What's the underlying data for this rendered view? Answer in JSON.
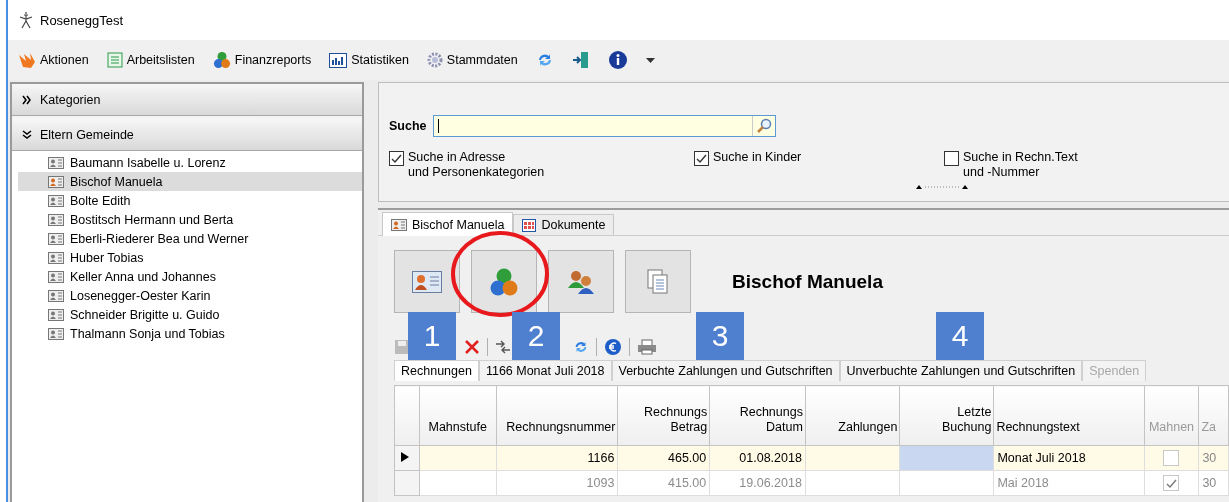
{
  "window": {
    "title": "RoseneggTest"
  },
  "toolbar": {
    "items": [
      {
        "label": "Aktionen"
      },
      {
        "label": "Arbeitslisten"
      },
      {
        "label": "Finanzreports"
      },
      {
        "label": "Statistiken"
      },
      {
        "label": "Stammdaten"
      }
    ]
  },
  "sidebar": {
    "sections": [
      {
        "label": "Kategorien",
        "expanded": false
      },
      {
        "label": "Eltern Gemeinde",
        "expanded": true,
        "items": [
          {
            "label": "Baumann Isabelle u. Lorenz",
            "selected": false
          },
          {
            "label": "Bischof Manuela",
            "selected": true
          },
          {
            "label": "Bolte Edith",
            "selected": false
          },
          {
            "label": "Bostitsch Hermann und Berta",
            "selected": false
          },
          {
            "label": "Eberli-Riederer Bea und Werner",
            "selected": false
          },
          {
            "label": "Huber Tobias",
            "selected": false
          },
          {
            "label": "Keller Anna und Johannes",
            "selected": false
          },
          {
            "label": "Losenegger-Oester Karin",
            "selected": false
          },
          {
            "label": "Schneider Brigitte u. Guido",
            "selected": false
          },
          {
            "label": "Thalmann Sonja und Tobias",
            "selected": false
          }
        ]
      }
    ]
  },
  "search": {
    "label": "Suche",
    "options": [
      {
        "label": "Suche in Adresse\nund Personenkategorien",
        "checked": true
      },
      {
        "label": "Suche in Kinder",
        "checked": true
      },
      {
        "label": "Suche in Rechn.Text\nund -Nummer",
        "checked": false
      }
    ]
  },
  "record_tabs": [
    {
      "label": "Bischof Manuela",
      "selected": true
    },
    {
      "label": "Dokumente",
      "selected": false
    }
  ],
  "record": {
    "name": "Bischof Manuela"
  },
  "sub_tabs": [
    {
      "label": "Rechnungen",
      "selected": true,
      "disabled": false
    },
    {
      "label": "1166 Monat Juli 2018",
      "selected": false,
      "disabled": false
    },
    {
      "label": "Verbuchte Zahlungen und Gutschriften",
      "selected": false,
      "disabled": false
    },
    {
      "label": "Unverbuchte Zahlungen und Gutschriften",
      "selected": false,
      "disabled": false
    },
    {
      "label": "Spenden",
      "selected": false,
      "disabled": true
    }
  ],
  "table": {
    "columns": [
      "Mahnstufe",
      "Rechnungsnummer",
      "Rechnungs\nBetrag",
      "Rechnungs\nDatum",
      "Zahlungen",
      "Letzte\nBuchung",
      "Rechnungstext",
      "Mahnen",
      "Za"
    ],
    "rows": [
      {
        "selected": true,
        "rechnungsnummer": "1166",
        "betrag": "465.00",
        "datum": "01.08.2018",
        "rechnungstext": "Monat Juli 2018",
        "mahnen": false,
        "column_9": "30"
      },
      {
        "selected": false,
        "rechnungsnummer": "1093",
        "betrag": "415.00",
        "datum": "19.06.2018",
        "rechnungstext": "Mai 2018",
        "mahnen": true,
        "column_9": "30"
      }
    ]
  },
  "annotations": {
    "markers": [
      "1",
      "2",
      "3",
      "4"
    ]
  }
}
